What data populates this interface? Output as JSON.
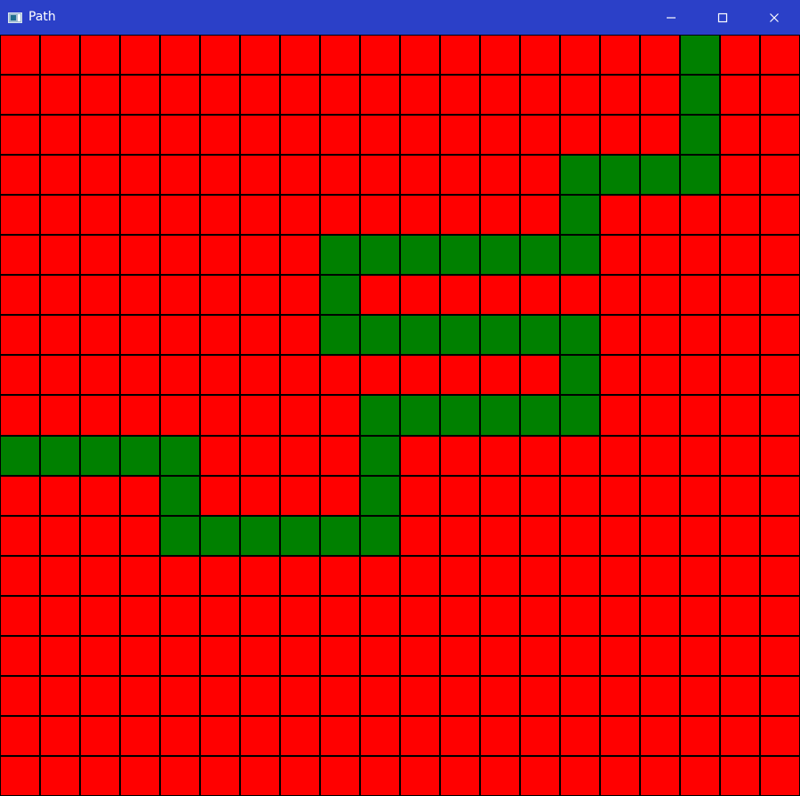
{
  "window": {
    "title": "Path",
    "icon": "app-window-icon",
    "controls": {
      "minimize_icon": "minimize-icon",
      "maximize_icon": "maximize-icon",
      "close_icon": "close-icon"
    },
    "title_bar_color": "#2b40c8"
  },
  "grid": {
    "rows": 19,
    "cols": 20,
    "colors": {
      "empty": "#ff0000",
      "path": "#008000",
      "border": "#000000"
    },
    "path_cells": [
      [
        0,
        17
      ],
      [
        1,
        17
      ],
      [
        2,
        17
      ],
      [
        3,
        14
      ],
      [
        3,
        15
      ],
      [
        3,
        16
      ],
      [
        3,
        17
      ],
      [
        4,
        14
      ],
      [
        5,
        8
      ],
      [
        5,
        9
      ],
      [
        5,
        10
      ],
      [
        5,
        11
      ],
      [
        5,
        12
      ],
      [
        5,
        13
      ],
      [
        5,
        14
      ],
      [
        6,
        8
      ],
      [
        7,
        8
      ],
      [
        7,
        9
      ],
      [
        7,
        10
      ],
      [
        7,
        11
      ],
      [
        7,
        12
      ],
      [
        7,
        13
      ],
      [
        7,
        14
      ],
      [
        8,
        14
      ],
      [
        9,
        9
      ],
      [
        9,
        10
      ],
      [
        9,
        11
      ],
      [
        9,
        12
      ],
      [
        9,
        13
      ],
      [
        9,
        14
      ],
      [
        10,
        0
      ],
      [
        10,
        1
      ],
      [
        10,
        2
      ],
      [
        10,
        3
      ],
      [
        10,
        4
      ],
      [
        10,
        9
      ],
      [
        11,
        4
      ],
      [
        11,
        9
      ],
      [
        12,
        4
      ],
      [
        12,
        5
      ],
      [
        12,
        6
      ],
      [
        12,
        7
      ],
      [
        12,
        8
      ],
      [
        12,
        9
      ]
    ]
  }
}
